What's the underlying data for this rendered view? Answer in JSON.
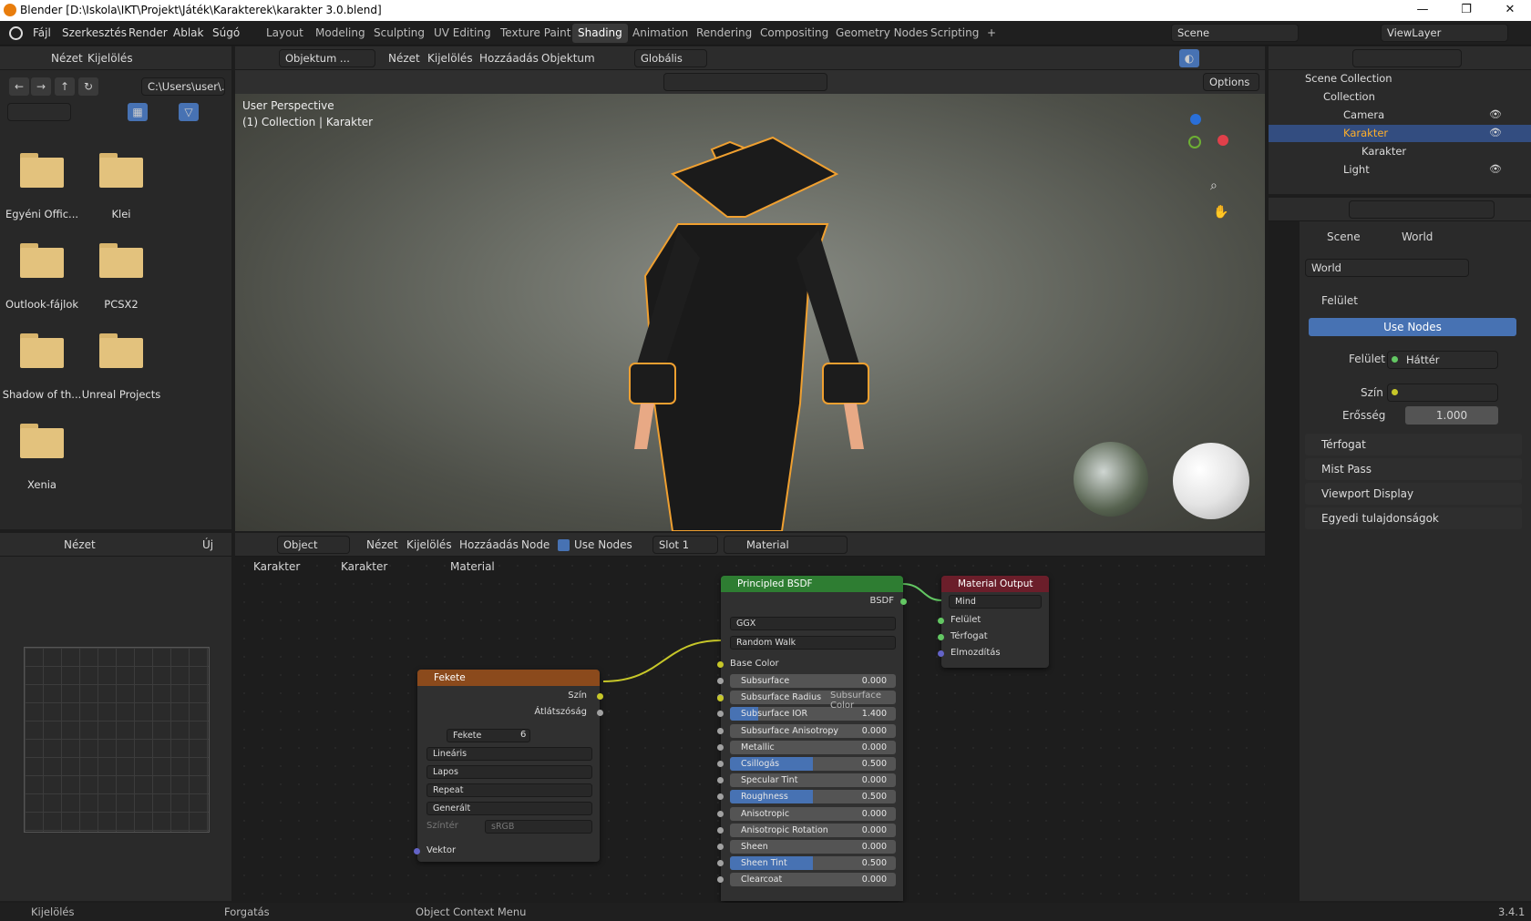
{
  "window": {
    "title": "Blender [D:\\Iskola\\IKT\\Projekt\\Játék\\Karakterek\\karakter 3.0.blend]",
    "min": "—",
    "max": "❐",
    "close": "✕"
  },
  "menu": [
    "Fájl",
    "Szerkesztés",
    "Render",
    "Ablak",
    "Súgó"
  ],
  "workspaces": [
    "Layout",
    "Modeling",
    "Sculpting",
    "UV Editing",
    "Texture Paint",
    "Shading",
    "Animation",
    "Rendering",
    "Compositing",
    "Geometry Nodes",
    "Scripting",
    "+"
  ],
  "active_workspace": "Shading",
  "scene": "Scene",
  "view_layer": "ViewLayer",
  "filebrowser": {
    "menu": [
      "Nézet",
      "Kijelölés"
    ],
    "path": "C:\\Users\\user\\...",
    "folders": [
      "Egyéni Offic...",
      "Klei",
      "Outlook-fájlok",
      "PCSX2",
      "Shadow of th...",
      "Unreal Projects",
      "Xenia"
    ]
  },
  "viewport": {
    "mode": "Objektum ...",
    "menu": [
      "Nézet",
      "Kijelölés",
      "Hozzáadás",
      "Objektum"
    ],
    "orientation": "Globális",
    "options": "Options",
    "label1": "User Perspective",
    "label2": "(1) Collection | Karakter"
  },
  "outliner": {
    "items": [
      {
        "label": "Scene Collection"
      },
      {
        "label": "Collection"
      },
      {
        "label": "Camera"
      },
      {
        "label": "Karakter"
      },
      {
        "label": "Karakter"
      },
      {
        "label": "Light"
      }
    ]
  },
  "properties": {
    "crumb1": "Scene",
    "crumb2": "World",
    "world_name": "World",
    "section_surface": "Felület",
    "use_nodes": "Use Nodes",
    "surface_label": "Felület",
    "surface_value": "Háttér",
    "color_label": "Szín",
    "strength_label": "Erősség",
    "strength_value": "1.000",
    "sections": [
      "Térfogat",
      "Mist Pass",
      "Viewport Display",
      "Egyedi tulajdonságok"
    ]
  },
  "image_editor": {
    "view": "Nézet",
    "new": "Új"
  },
  "node_editor": {
    "type": "Object",
    "menu": [
      "Nézet",
      "Kijelölés",
      "Hozzáadás",
      "Node"
    ],
    "use_nodes": "Use Nodes",
    "slot": "Slot 1",
    "material": "Material",
    "crumbs": [
      "Karakter",
      "Karakter",
      "Material"
    ]
  },
  "node_texture": {
    "title": "Fekete",
    "out_color": "Szín",
    "out_alpha": "Átlátszóság",
    "image": "Fekete",
    "users": "6",
    "interp": "Lineáris",
    "proj": "Lapos",
    "ext": "Repeat",
    "source": "Generált",
    "colorspace_label": "Színtér",
    "colorspace": "sRGB",
    "vector": "Vektor"
  },
  "node_bsdf": {
    "title": "Principled BSDF",
    "out": "BSDF",
    "dist": "GGX",
    "sss": "Random Walk",
    "base_color": "Base Color",
    "sss_color": "Subsurface Color",
    "sliders": [
      {
        "label": "Subsurface",
        "value": "0.000",
        "fill": 0
      },
      {
        "label": "Subsurface Radius",
        "value": "",
        "fill": 0
      },
      {
        "label": "Subsurface IOR",
        "value": "1.400",
        "fill": 0.17
      },
      {
        "label": "Subsurface Anisotropy",
        "value": "0.000",
        "fill": 0
      },
      {
        "label": "Metallic",
        "value": "0.000",
        "fill": 0
      },
      {
        "label": "Csillogás",
        "value": "0.500",
        "fill": 0.5
      },
      {
        "label": "Specular Tint",
        "value": "0.000",
        "fill": 0
      },
      {
        "label": "Roughness",
        "value": "0.500",
        "fill": 0.5
      },
      {
        "label": "Anisotropic",
        "value": "0.000",
        "fill": 0
      },
      {
        "label": "Anisotropic Rotation",
        "value": "0.000",
        "fill": 0
      },
      {
        "label": "Sheen",
        "value": "0.000",
        "fill": 0
      },
      {
        "label": "Sheen Tint",
        "value": "0.500",
        "fill": 0.5
      },
      {
        "label": "Clearcoat",
        "value": "0.000",
        "fill": 0
      }
    ]
  },
  "node_output": {
    "title": "Material Output",
    "target": "Mind",
    "in1": "Felület",
    "in2": "Térfogat",
    "in3": "Elmozdítás"
  },
  "status": {
    "left": "Kijelölés",
    "mid": "Forgatás",
    "right": "Object Context Menu",
    "version": "3.4.1"
  }
}
